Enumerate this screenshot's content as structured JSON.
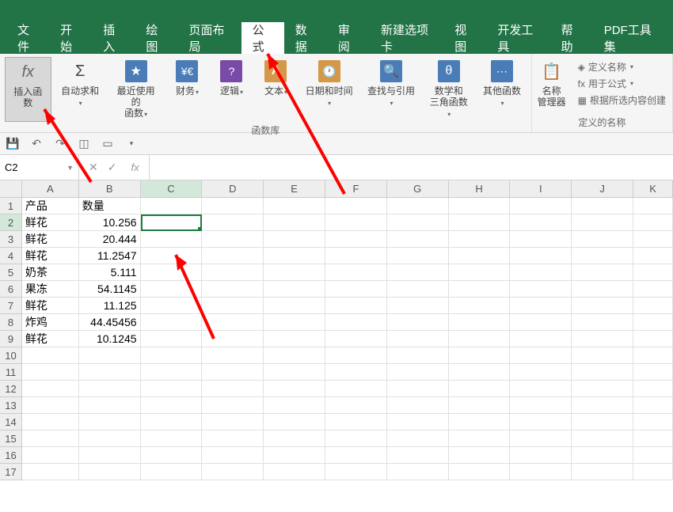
{
  "menu": {
    "items": [
      "文件",
      "开始",
      "插入",
      "绘图",
      "页面布局",
      "公式",
      "数据",
      "审阅",
      "新建选项卡",
      "视图",
      "开发工具",
      "帮助",
      "PDF工具集"
    ],
    "active_index": 5
  },
  "ribbon": {
    "insert_fn": "插入函数",
    "auto_sum": "自动求和",
    "recent": "最近使用的\n函数",
    "financial": "财务",
    "logical": "逻辑",
    "text": "文本",
    "datetime": "日期和时间",
    "lookup": "查找与引用",
    "math_trig": "数学和\n三角函数",
    "more_fn": "其他函数",
    "group1_title": "函数库",
    "name_mgr": "名称\n管理器",
    "define_name": "定义名称",
    "use_formula": "用于公式",
    "create_from_sel": "根据所选内容创建",
    "group2_title": "定义的名称"
  },
  "qat": {
    "save": "💾"
  },
  "formula_bar": {
    "cell_ref": "C2",
    "fx": "fx"
  },
  "columns": [
    "A",
    "B",
    "C",
    "D",
    "E",
    "F",
    "G",
    "H",
    "I",
    "J",
    "K"
  ],
  "selected_cell": "C2",
  "data": {
    "headers": {
      "A": "产品",
      "B": "数量"
    },
    "rows": [
      {
        "A": "鲜花",
        "B": "10.256"
      },
      {
        "A": "鲜花",
        "B": "20.444"
      },
      {
        "A": "鲜花",
        "B": "11.2547"
      },
      {
        "A": "奶茶",
        "B": "5.111"
      },
      {
        "A": "果冻",
        "B": "54.1145"
      },
      {
        "A": "鲜花",
        "B": "11.125"
      },
      {
        "A": "炸鸡",
        "B": "44.45456"
      },
      {
        "A": "鲜花",
        "B": "10.1245"
      }
    ]
  }
}
